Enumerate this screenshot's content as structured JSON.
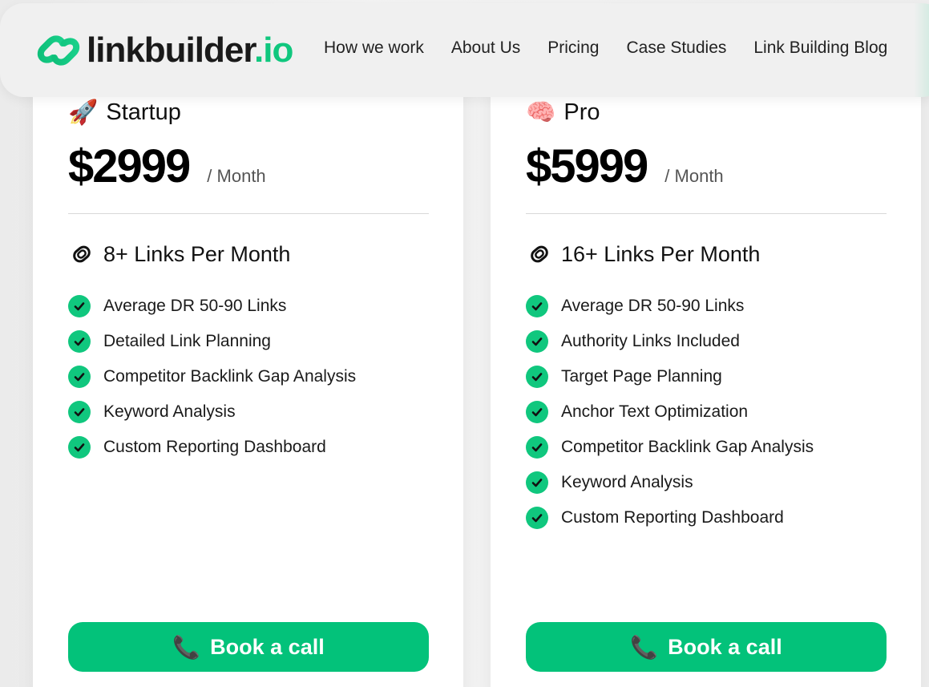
{
  "brand": {
    "name": "linkbuilder",
    "dot": ".",
    "tld": "io",
    "accent": "#10c77e"
  },
  "nav": {
    "items": [
      {
        "label": "How we work"
      },
      {
        "label": "About Us"
      },
      {
        "label": "Pricing"
      },
      {
        "label": "Case Studies"
      },
      {
        "label": "Link Building Blog"
      }
    ]
  },
  "plans": [
    {
      "icon": "rocket-icon",
      "emoji": "🚀",
      "name": "Startup",
      "price": "$2999",
      "period": "/ Month",
      "links_heading": "8+ Links Per Month",
      "features": [
        "Average DR 50-90 Links",
        "Detailed Link Planning",
        "Competitor Backlink Gap Analysis",
        "Keyword Analysis",
        "Custom Reporting Dashboard"
      ],
      "cta": {
        "icon": "phone-icon",
        "emoji": "📞",
        "label": "Book a call"
      }
    },
    {
      "icon": "brain-icon",
      "emoji": "🧠",
      "name": "Pro",
      "price": "$5999",
      "period": "/ Month",
      "links_heading": "16+ Links Per Month",
      "features": [
        "Average DR 50-90 Links",
        "Authority Links Included",
        "Target Page Planning",
        "Anchor Text Optimization",
        "Competitor Backlink Gap Analysis",
        "Keyword Analysis",
        "Custom Reporting Dashboard"
      ],
      "cta": {
        "icon": "phone-icon",
        "emoji": "📞",
        "label": "Book a call"
      }
    }
  ]
}
